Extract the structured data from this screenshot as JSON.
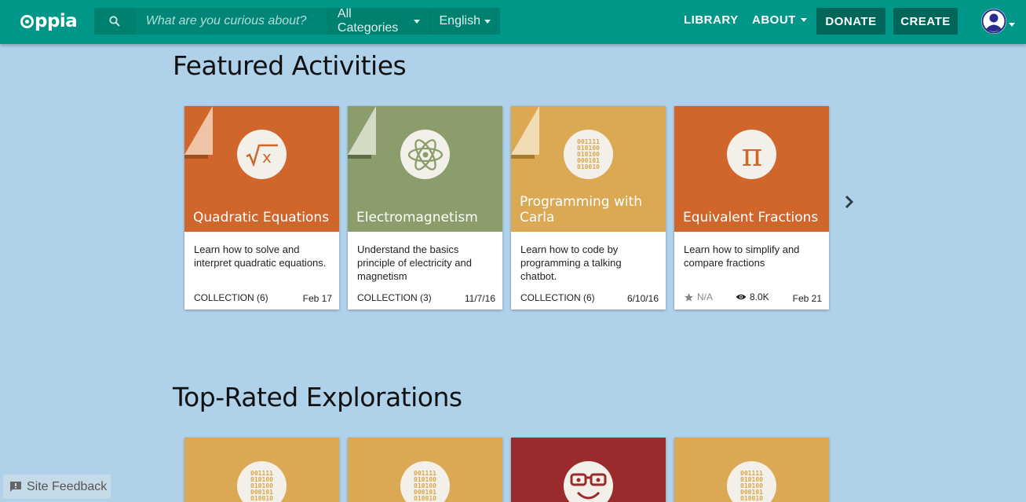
{
  "brand": {
    "logo_text": "ppia",
    "colors": {
      "navbar": "#009688",
      "page_bg": "#afd2ea"
    }
  },
  "search": {
    "placeholder": "What are you curious about?",
    "category": "All Categories",
    "language": "English"
  },
  "nav": {
    "library": "LIBRARY",
    "about": "ABOUT",
    "donate": "DONATE",
    "create": "CREATE"
  },
  "featured": {
    "title": "Featured Activities",
    "cards": [
      {
        "title": "Quadratic Equations",
        "description": "Learn how to solve and interpret quadratic equations.",
        "type": "COLLECTION (6)",
        "date": "Feb 17",
        "color": "#d0662b",
        "icon": "sqrt-x-icon"
      },
      {
        "title": "Electromagnetism",
        "description": "Understand the basics principle of electricity and magnetism",
        "type": "COLLECTION (3)",
        "date": "11/7/16",
        "color": "#8a9d6b",
        "icon": "atom-icon"
      },
      {
        "title": "Programming with Carla",
        "description": "Learn how to code by programming a talking chatbot.",
        "type": "COLLECTION (6)",
        "date": "6/10/16",
        "color": "#dba954",
        "icon": "binary-icon"
      },
      {
        "title": "Equivalent Fractions",
        "description": "Learn how to simplify and compare fractions",
        "rating": "N/A",
        "views": "8.0K",
        "date": "Feb 21",
        "color": "#d0662b",
        "icon": "pi-icon"
      }
    ]
  },
  "top_rated": {
    "title": "Top-Rated Explorations",
    "cards": [
      {
        "color": "#dba954",
        "icon": "binary-icon"
      },
      {
        "color": "#dba954",
        "icon": "binary-icon"
      },
      {
        "color": "#9b2a2c",
        "icon": "smiley-glasses-icon"
      },
      {
        "color": "#dba954",
        "icon": "binary-icon"
      }
    ]
  },
  "binary_lines": [
    "001111",
    "010100",
    "010100",
    "000101",
    "010010"
  ],
  "feedback": {
    "label": "Site Feedback"
  }
}
